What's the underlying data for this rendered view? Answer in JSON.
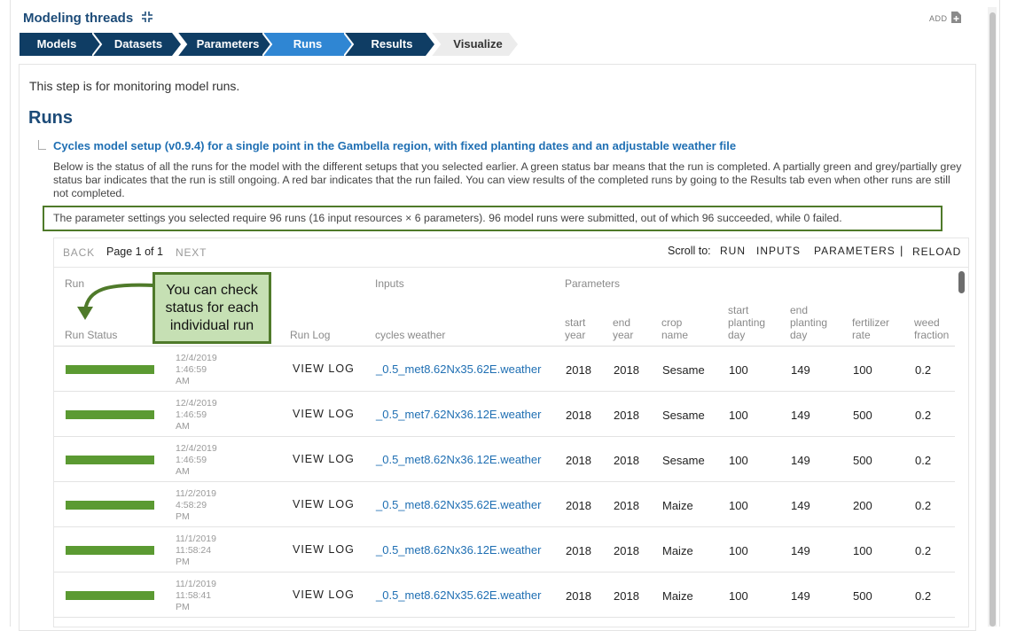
{
  "header": {
    "title": "Modeling threads",
    "add_label": "ADD"
  },
  "steps": [
    {
      "label": "Models"
    },
    {
      "label": "Datasets"
    },
    {
      "label": "Parameters"
    },
    {
      "label": "Runs"
    },
    {
      "label": "Results"
    },
    {
      "label": "Visualize"
    }
  ],
  "colors": {
    "step_dark": "#0f3d64",
    "step_active": "#2f86d3",
    "step_inactive": "#ececec",
    "status_green": "#5b9a32",
    "accent_border": "#4f7a2a",
    "callout_bg": "#c6e0b4",
    "link": "#1f6fb3"
  },
  "intro": "This step is for monitoring model runs.",
  "section_title": "Runs",
  "setup_title": "Cycles model setup (v0.9.4) for a single point in the Gambella region, with fixed planting dates and an adjustable weather file",
  "description": "Below is the status of all the runs for the model with the different setups that you selected earlier. A green status bar means that the run is completed. A partially green and grey/partially grey status bar indicates that the run is still ongoing. A red bar indicates that the run failed. You can view results of the completed runs by going to the Results tab even when other runs are still not completed.",
  "summary": "The parameter settings you selected require 96 runs (16 input resources × 6 parameters). 96 model runs were submitted, out of which 96 succeeded, while 0 failed.",
  "pager": {
    "back": "BACK",
    "page": "Page 1 of 1",
    "next": "NEXT"
  },
  "toolbar": {
    "scroll_to": "Scroll to:",
    "run": "RUN",
    "inputs": "INPUTS",
    "parameters": "PARAMETERS",
    "sep": "|",
    "reload": "RELOAD"
  },
  "table_headers": {
    "group_run": "Run",
    "group_inputs": "Inputs",
    "group_parameters": "Parameters",
    "run_status": "Run Status",
    "run_log": "Run Log",
    "cycles_weather": "cycles weather",
    "start_year": "start year",
    "end_year": "end year",
    "crop_name": "crop name",
    "start_planting_day": "start planting day",
    "end_planting_day": "end planting day",
    "fertilizer_rate": "fertilizer rate",
    "weed_fraction": "weed fraction"
  },
  "rows": [
    {
      "status": "completed",
      "progress": 1.0,
      "date": "12/4/2019",
      "time": "1:46:59",
      "ampm": "AM",
      "log": "VIEW LOG",
      "weather": "_0.5_met8.62Nx35.62E.weather",
      "start_year": "2018",
      "end_year": "2018",
      "crop": "Sesame",
      "start_day": "100",
      "end_day": "149",
      "fert": "100",
      "weed": "0.2"
    },
    {
      "status": "completed",
      "progress": 1.0,
      "date": "12/4/2019",
      "time": "1:46:59",
      "ampm": "AM",
      "log": "VIEW LOG",
      "weather": "_0.5_met7.62Nx36.12E.weather",
      "start_year": "2018",
      "end_year": "2018",
      "crop": "Sesame",
      "start_day": "100",
      "end_day": "149",
      "fert": "500",
      "weed": "0.2"
    },
    {
      "status": "completed",
      "progress": 1.0,
      "date": "12/4/2019",
      "time": "1:46:59",
      "ampm": "AM",
      "log": "VIEW LOG",
      "weather": "_0.5_met8.62Nx36.12E.weather",
      "start_year": "2018",
      "end_year": "2018",
      "crop": "Sesame",
      "start_day": "100",
      "end_day": "149",
      "fert": "500",
      "weed": "0.2"
    },
    {
      "status": "completed",
      "progress": 1.0,
      "date": "11/2/2019",
      "time": "4:58:29",
      "ampm": "PM",
      "log": "VIEW LOG",
      "weather": "_0.5_met8.62Nx35.62E.weather",
      "start_year": "2018",
      "end_year": "2018",
      "crop": "Maize",
      "start_day": "100",
      "end_day": "149",
      "fert": "200",
      "weed": "0.2"
    },
    {
      "status": "completed",
      "progress": 1.0,
      "date": "11/1/2019",
      "time": "11:58:24",
      "ampm": "PM",
      "log": "VIEW LOG",
      "weather": "_0.5_met8.62Nx36.12E.weather",
      "start_year": "2018",
      "end_year": "2018",
      "crop": "Maize",
      "start_day": "100",
      "end_day": "149",
      "fert": "100",
      "weed": "0.2"
    },
    {
      "status": "completed",
      "progress": 1.0,
      "date": "11/1/2019",
      "time": "11:58:41",
      "ampm": "PM",
      "log": "VIEW LOG",
      "weather": "_0.5_met8.62Nx35.62E.weather",
      "start_year": "2018",
      "end_year": "2018",
      "crop": "Maize",
      "start_day": "100",
      "end_day": "149",
      "fert": "500",
      "weed": "0.2"
    }
  ],
  "callout": "You can check status for each individual run"
}
